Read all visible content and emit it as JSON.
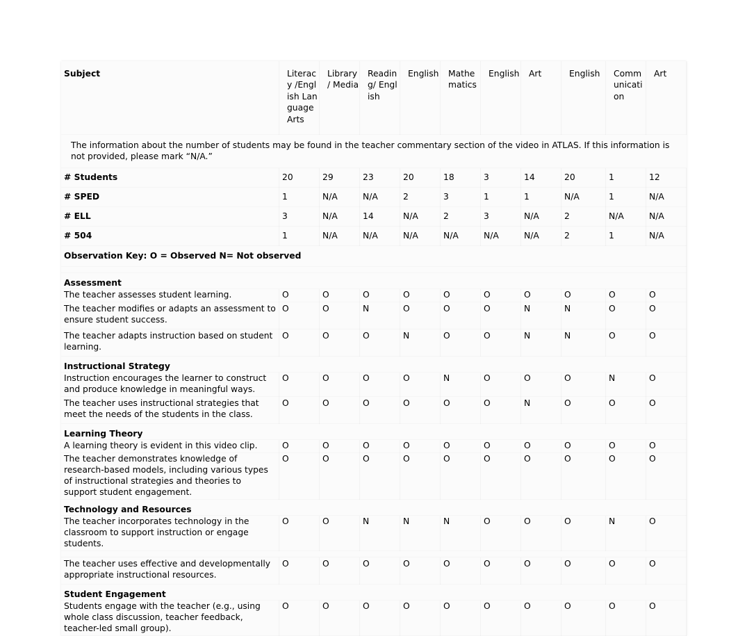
{
  "table": {
    "row_label_header": "Subject",
    "column_headers": [
      "Literacy /English Language Arts",
      "Library / Media",
      "Reading/ English",
      "English",
      "Mathematics",
      "English",
      "Art",
      "English",
      "Communication",
      "Art"
    ],
    "note": "The information about the number of students may be found in the teacher commentary section of the video in ATLAS. If this information is not provided, please mark “N/A.”",
    "observation_key": "Observation Key: O = Observed N= Not observed",
    "count_rows": [
      {
        "label": "# Students",
        "values": [
          "20",
          "29",
          "23",
          "20",
          "18",
          "3",
          "14",
          "20",
          "1",
          "12"
        ]
      },
      {
        "label": "# SPED",
        "values": [
          "1",
          "N/A",
          "N/A",
          "2",
          "3",
          "1",
          "1",
          "N/A",
          "1",
          "N/A"
        ]
      },
      {
        "label": "# ELL",
        "values": [
          "3",
          "N/A",
          "14",
          "N/A",
          "2",
          "3",
          "N/A",
          "2",
          "N/A",
          "N/A"
        ]
      },
      {
        "label": "# 504",
        "values": [
          "1",
          "N/A",
          "N/A",
          "N/A",
          "N/A",
          "N/A",
          "N/A",
          "2",
          "1",
          "N/A"
        ]
      }
    ],
    "sections": [
      {
        "title": "Assessment",
        "items": [
          {
            "text": "The teacher assesses student learning.",
            "values": [
              "O",
              "O",
              "O",
              "O",
              "O",
              "O",
              "O",
              "O",
              "O",
              "O"
            ]
          },
          {
            "text": "The teacher modifies or adapts an assessment to ensure student success.",
            "values": [
              "O",
              "O",
              "N",
              "O",
              "O",
              "O",
              "N",
              "N",
              "O",
              "O"
            ]
          },
          {
            "text": "The teacher adapts instruction based on student learning.",
            "values": [
              "O",
              "O",
              "O",
              "N",
              "O",
              "O",
              "N",
              "N",
              "O",
              "O"
            ]
          }
        ]
      },
      {
        "title": "Instructional Strategy",
        "items": [
          {
            "text": "Instruction encourages the learner to construct and produce knowledge in meaningful ways.",
            "values": [
              "O",
              "O",
              "O",
              "O",
              "N",
              "O",
              "O",
              "O",
              "N",
              "O"
            ]
          },
          {
            "text": "The teacher uses instructional strategies that meet the needs of the students in the class.",
            "values": [
              "O",
              "O",
              "O",
              "O",
              "O",
              "O",
              "N",
              "O",
              "O",
              "O"
            ]
          }
        ]
      },
      {
        "title": "Learning Theory",
        "items": [
          {
            "text": "A learning theory is evident in this video clip.",
            "values": [
              "O",
              "O",
              "O",
              "O",
              "O",
              "O",
              "O",
              "O",
              "O",
              "O"
            ]
          },
          {
            "text": "The teacher demonstrates knowledge of research-based models, including various types of instructional strategies and theories to support student engagement.",
            "values": [
              "O",
              "O",
              "O",
              "O",
              "O",
              "O",
              "O",
              "O",
              "O",
              "O"
            ]
          }
        ]
      },
      {
        "title": "Technology and Resources",
        "items": [
          {
            "text": "The teacher incorporates technology in the classroom to support instruction or engage students.",
            "values": [
              "O",
              "O",
              "N",
              "N",
              "N",
              "O",
              "O",
              "O",
              "N",
              "O"
            ]
          },
          {
            "text": "The teacher uses effective and developmentally appropriate instructional resources.",
            "values": [
              "O",
              "O",
              "O",
              "O",
              "O",
              "O",
              "O",
              "O",
              "O",
              "O"
            ]
          }
        ]
      },
      {
        "title": "Student Engagement",
        "items": [
          {
            "text": "Students engage with the teacher (e.g., using whole class discussion, teacher feedback, teacher-led small group).",
            "values": [
              "O",
              "O",
              "O",
              "O",
              "O",
              "O",
              "O",
              "O",
              "O",
              "O"
            ]
          }
        ]
      }
    ]
  }
}
